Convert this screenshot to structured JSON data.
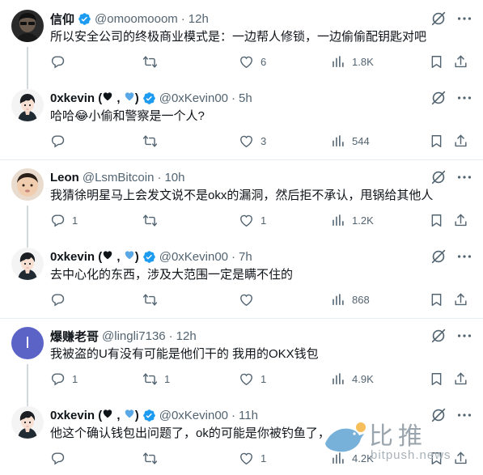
{
  "colors": {
    "verified": "#1d9bf0",
    "text": "#0f1419",
    "muted": "#536471",
    "line": "#cfd9de"
  },
  "tweets": [
    {
      "name": "信仰",
      "handle": "@omoomooom",
      "dot": "·",
      "time": "12h",
      "text": "所以安全公司的终极商业模式是：一边帮人修锁，一边偷偷配钥匙对吧",
      "reply_count": "",
      "retweet_count": "",
      "like_count": "6",
      "view_count": "1.8K",
      "avatar": "dark-photo"
    },
    {
      "name_prefix": "0xkevin (",
      "name_suffix": ")",
      "handle": "@0xKevin00",
      "dot": "·",
      "time": "5h",
      "text": "哈哈😂小偷和警察是一个人?",
      "reply_count": "",
      "retweet_count": "",
      "like_count": "3",
      "view_count": "544",
      "avatar": "anime-boy"
    },
    {
      "name": "Leon",
      "handle": "@LsmBitcoin",
      "dot": "·",
      "time": "10h",
      "text": "我猜徐明星马上会发文说不是okx的漏洞，然后拒不承认，甩锅给其他人",
      "reply_count": "1",
      "retweet_count": "",
      "like_count": "1",
      "view_count": "1.2K",
      "avatar": "baby-photo"
    },
    {
      "name_prefix": "0xkevin (",
      "name_suffix": ")",
      "handle": "@0xKevin00",
      "dot": "·",
      "time": "7h",
      "text": "去中心化的东西，涉及大范围一定是瞒不住的",
      "reply_count": "",
      "retweet_count": "",
      "like_count": "",
      "view_count": "868",
      "avatar": "anime-boy"
    },
    {
      "name": "爆赚老哥",
      "handle": "@lingli7136",
      "dot": "·",
      "time": "12h",
      "text": "我被盗的U有没有可能是他们干的 我用的OKX钱包",
      "reply_count": "1",
      "retweet_count": "1",
      "like_count": "1",
      "view_count": "4.9K",
      "avatar": "letter",
      "avatar_letter": "I"
    },
    {
      "name_prefix": "0xkevin (",
      "name_suffix": ")",
      "handle": "@0xKevin00",
      "dot": "·",
      "time": "11h",
      "text": "他这个确认钱包出问题了，ok的可能是你被钓鱼了，",
      "reply_count": "",
      "retweet_count": "",
      "like_count": "1",
      "view_count": "4.2K",
      "avatar": "anime-boy"
    }
  ],
  "watermark": {
    "text": "比推",
    "sub": "bitpush.news"
  }
}
